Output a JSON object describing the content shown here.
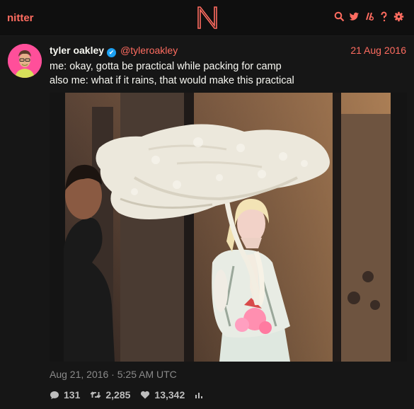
{
  "nav": {
    "brand": "nitter",
    "icons": [
      "search-icon",
      "twitter-icon",
      "rss-icon",
      "about-icon",
      "settings-icon"
    ]
  },
  "colors": {
    "accent": "#ff6c60",
    "verified": "#1da1f2",
    "background": "#0f0f0f",
    "card": "#161616"
  },
  "tweet": {
    "fullname": "tyler oakley",
    "username": "@tyleroakley",
    "date": "21 Aug 2016",
    "lines": [
      "me: okay, gotta be practical while packing for camp",
      "also me: what if it rains, that would make this practical"
    ],
    "timestamp": "Aug 21, 2016 · 5:25 AM UTC",
    "stats": {
      "replies": "131",
      "retweets": "2,285",
      "likes": "13,342"
    }
  }
}
